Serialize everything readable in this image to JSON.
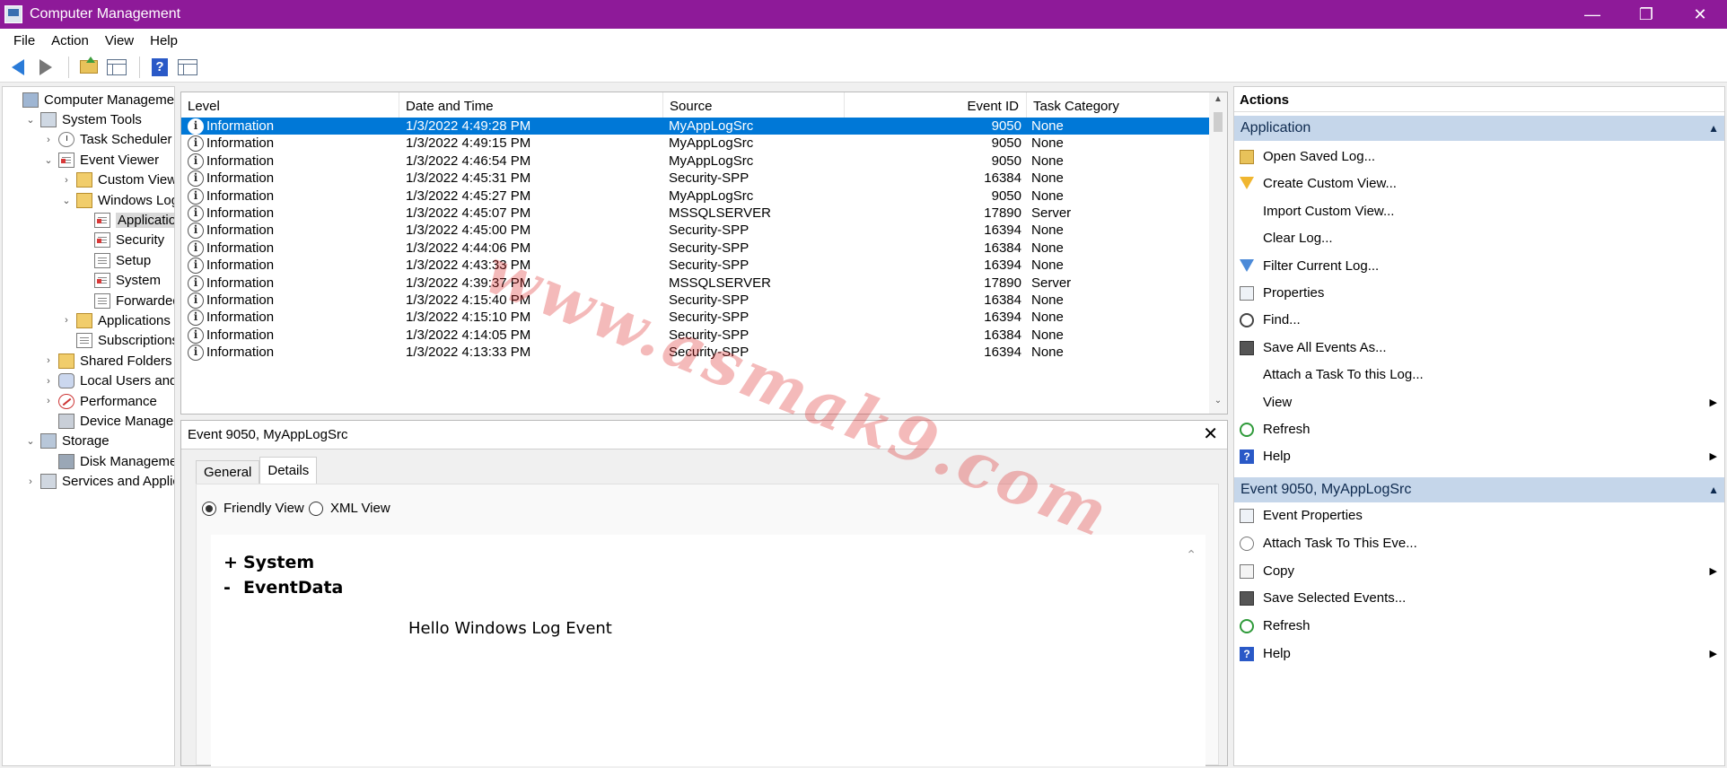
{
  "window": {
    "title": "Computer Management"
  },
  "menu": [
    "File",
    "Action",
    "View",
    "Help"
  ],
  "toolbar": [
    "back-icon",
    "forward-icon",
    "up-folder-icon",
    "show-hide-console-tree-icon",
    "help-icon",
    "show-hide-action-pane-icon"
  ],
  "tree": [
    {
      "label": "Computer Management (Local)",
      "indent": 0,
      "exp": "",
      "icon": "computer"
    },
    {
      "label": "System Tools",
      "indent": 1,
      "exp": "⌄",
      "icon": "tools"
    },
    {
      "label": "Task Scheduler",
      "indent": 2,
      "exp": "›",
      "icon": "clock"
    },
    {
      "label": "Event Viewer",
      "indent": 2,
      "exp": "⌄",
      "icon": "log log-red"
    },
    {
      "label": "Custom Views",
      "indent": 3,
      "exp": "›",
      "icon": "folder"
    },
    {
      "label": "Windows Logs",
      "indent": 3,
      "exp": "⌄",
      "icon": "folder"
    },
    {
      "label": "Application",
      "indent": 4,
      "exp": "",
      "icon": "log log-red",
      "selected": true
    },
    {
      "label": "Security",
      "indent": 4,
      "exp": "",
      "icon": "log log-red"
    },
    {
      "label": "Setup",
      "indent": 4,
      "exp": "",
      "icon": "log"
    },
    {
      "label": "System",
      "indent": 4,
      "exp": "",
      "icon": "log log-red"
    },
    {
      "label": "Forwarded Events",
      "indent": 4,
      "exp": "",
      "icon": "log"
    },
    {
      "label": "Applications and Services Logs",
      "indent": 3,
      "exp": "›",
      "icon": "folder"
    },
    {
      "label": "Subscriptions",
      "indent": 3,
      "exp": "",
      "icon": "log"
    },
    {
      "label": "Shared Folders",
      "indent": 2,
      "exp": "›",
      "icon": "folder"
    },
    {
      "label": "Local Users and Groups",
      "indent": 2,
      "exp": "›",
      "icon": "people"
    },
    {
      "label": "Performance",
      "indent": 2,
      "exp": "›",
      "icon": "perf"
    },
    {
      "label": "Device Manager",
      "indent": 2,
      "exp": "",
      "icon": "device"
    },
    {
      "label": "Storage",
      "indent": 1,
      "exp": "⌄",
      "icon": "storage"
    },
    {
      "label": "Disk Management",
      "indent": 2,
      "exp": "",
      "icon": "disk"
    },
    {
      "label": "Services and Applications",
      "indent": 1,
      "exp": "›",
      "icon": "services"
    }
  ],
  "events": {
    "columns": [
      "Level",
      "Date and Time",
      "Source",
      "Event ID",
      "Task Category"
    ],
    "rows": [
      {
        "level": "Information",
        "datetime": "1/3/2022 4:49:28 PM",
        "source": "MyAppLogSrc",
        "id": "9050",
        "category": "None",
        "selected": true
      },
      {
        "level": "Information",
        "datetime": "1/3/2022 4:49:15 PM",
        "source": "MyAppLogSrc",
        "id": "9050",
        "category": "None"
      },
      {
        "level": "Information",
        "datetime": "1/3/2022 4:46:54 PM",
        "source": "MyAppLogSrc",
        "id": "9050",
        "category": "None"
      },
      {
        "level": "Information",
        "datetime": "1/3/2022 4:45:31 PM",
        "source": "Security-SPP",
        "id": "16384",
        "category": "None"
      },
      {
        "level": "Information",
        "datetime": "1/3/2022 4:45:27 PM",
        "source": "MyAppLogSrc",
        "id": "9050",
        "category": "None"
      },
      {
        "level": "Information",
        "datetime": "1/3/2022 4:45:07 PM",
        "source": "MSSQLSERVER",
        "id": "17890",
        "category": "Server"
      },
      {
        "level": "Information",
        "datetime": "1/3/2022 4:45:00 PM",
        "source": "Security-SPP",
        "id": "16394",
        "category": "None"
      },
      {
        "level": "Information",
        "datetime": "1/3/2022 4:44:06 PM",
        "source": "Security-SPP",
        "id": "16384",
        "category": "None"
      },
      {
        "level": "Information",
        "datetime": "1/3/2022 4:43:33 PM",
        "source": "Security-SPP",
        "id": "16394",
        "category": "None"
      },
      {
        "level": "Information",
        "datetime": "1/3/2022 4:39:37 PM",
        "source": "MSSQLSERVER",
        "id": "17890",
        "category": "Server"
      },
      {
        "level": "Information",
        "datetime": "1/3/2022 4:15:40 PM",
        "source": "Security-SPP",
        "id": "16384",
        "category": "None"
      },
      {
        "level": "Information",
        "datetime": "1/3/2022 4:15:10 PM",
        "source": "Security-SPP",
        "id": "16394",
        "category": "None"
      },
      {
        "level": "Information",
        "datetime": "1/3/2022 4:14:05 PM",
        "source": "Security-SPP",
        "id": "16384",
        "category": "None"
      },
      {
        "level": "Information",
        "datetime": "1/3/2022 4:13:33 PM",
        "source": "Security-SPP",
        "id": "16394",
        "category": "None"
      }
    ]
  },
  "detail": {
    "title": "Event 9050, MyAppLogSrc",
    "tabs": [
      "General",
      "Details"
    ],
    "active_tab": "Details",
    "radio_friendly": "Friendly View",
    "radio_xml": "XML View",
    "system_label": "System",
    "system_sign": "+",
    "eventdata_label": "EventData",
    "eventdata_sign": "-",
    "eventdata_value": "Hello Windows Log Event"
  },
  "actions": {
    "title": "Actions",
    "section1": {
      "header": "Application",
      "items": [
        {
          "label": "Open Saved Log...",
          "icon": "open",
          "name": "open-saved-log"
        },
        {
          "label": "Create Custom View...",
          "icon": "filter",
          "name": "create-custom-view"
        },
        {
          "label": "Import Custom View...",
          "icon": "",
          "name": "import-custom-view"
        },
        {
          "label": "Clear Log...",
          "icon": "",
          "name": "clear-log"
        },
        {
          "label": "Filter Current Log...",
          "icon": "filter2",
          "name": "filter-current-log"
        },
        {
          "label": "Properties",
          "icon": "props",
          "name": "properties"
        },
        {
          "label": "Find...",
          "icon": "find",
          "name": "find"
        },
        {
          "label": "Save All Events As...",
          "icon": "save",
          "name": "save-all-events"
        },
        {
          "label": "Attach a Task To this Log...",
          "icon": "",
          "name": "attach-task-log"
        },
        {
          "label": "View",
          "icon": "",
          "name": "view",
          "submenu": true
        },
        {
          "label": "Refresh",
          "icon": "refresh",
          "name": "refresh"
        },
        {
          "label": "Help",
          "icon": "help",
          "name": "help",
          "submenu": true
        }
      ]
    },
    "section2": {
      "header": "Event 9050, MyAppLogSrc",
      "items": [
        {
          "label": "Event Properties",
          "icon": "props",
          "name": "event-properties"
        },
        {
          "label": "Attach Task To This Eve...",
          "icon": "clock",
          "name": "attach-task-event"
        },
        {
          "label": "Copy",
          "icon": "copy",
          "name": "copy",
          "submenu": true
        },
        {
          "label": "Save Selected Events...",
          "icon": "save",
          "name": "save-selected-events"
        },
        {
          "label": "Refresh",
          "icon": "refresh",
          "name": "refresh-event"
        },
        {
          "label": "Help",
          "icon": "help",
          "name": "help-event",
          "submenu": true
        }
      ]
    }
  },
  "watermark": "www.asmak9.com",
  "colors": {
    "titlebar": "#8e1a99",
    "selection": "#0078d7",
    "section_header": "#c5d6ea"
  }
}
